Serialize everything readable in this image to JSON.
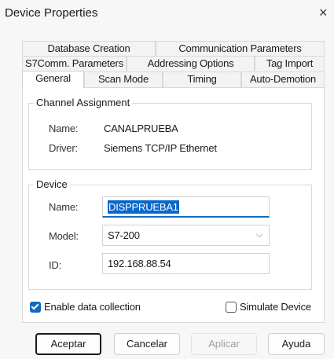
{
  "window": {
    "title": "Device Properties",
    "close_glyph": "×"
  },
  "tabs": {
    "row1": [
      "Database Creation",
      "Communication Parameters"
    ],
    "row2": [
      "S7Comm. Parameters",
      "Addressing Options",
      "Tag Import"
    ],
    "row3": [
      "General",
      "Scan Mode",
      "Timing",
      "Auto-Demotion"
    ],
    "active": "General"
  },
  "channel": {
    "legend": "Channel Assignment",
    "name_label": "Name:",
    "name_value": "CANALPRUEBA",
    "driver_label": "Driver:",
    "driver_value": "Siemens TCP/IP Ethernet"
  },
  "device": {
    "legend": "Device",
    "name_label": "Name:",
    "name_value": "DISPPRUEBA1",
    "model_label": "Model:",
    "model_value": "S7-200",
    "id_label": "ID:",
    "id_value": "192.168.88.54"
  },
  "options": {
    "enable_label": "Enable data collection",
    "enable_checked": true,
    "simulate_label": "Simulate Device",
    "simulate_checked": false
  },
  "buttons": {
    "accept": "Aceptar",
    "cancel": "Cancelar",
    "apply": "Aplicar",
    "help": "Ayuda"
  },
  "colors": {
    "accent": "#0f6cbd",
    "selection": "#0a68cc"
  },
  "icons": {
    "close": "close-icon",
    "dropdown": "chevron-down-icon",
    "check": "checkmark-icon"
  }
}
